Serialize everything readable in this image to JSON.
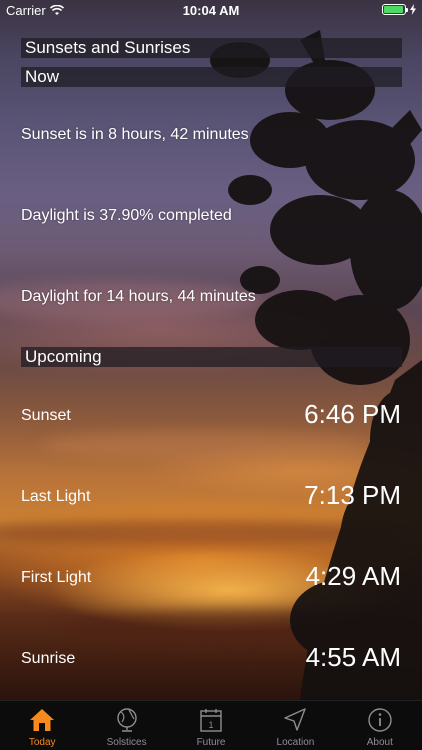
{
  "status_bar": {
    "carrier": "Carrier",
    "time": "10:04 AM",
    "battery_level": 0.95
  },
  "app_title": "Sunsets and Sunrises",
  "now_section": {
    "header": "Now",
    "sunset_countdown": "Sunset is in 8 hours, 42 minutes",
    "daylight_completed": "Daylight is 37.90% completed",
    "daylight_duration": "Daylight for 14 hours, 44 minutes"
  },
  "upcoming_section": {
    "header": "Upcoming",
    "events": [
      {
        "label": "Sunset",
        "time": "6:46 PM"
      },
      {
        "label": "Last Light",
        "time": "7:13 PM"
      },
      {
        "label": "First Light",
        "time": "4:29 AM"
      },
      {
        "label": "Sunrise",
        "time": "4:55 AM"
      }
    ]
  },
  "tab_bar": {
    "tabs": [
      {
        "label": "Today",
        "icon": "home-icon",
        "active": true
      },
      {
        "label": "Solstices",
        "icon": "globe-icon",
        "active": false
      },
      {
        "label": "Future",
        "icon": "calendar-icon",
        "active": false
      },
      {
        "label": "Location",
        "icon": "location-arrow-icon",
        "active": false
      },
      {
        "label": "About",
        "icon": "info-icon",
        "active": false
      }
    ]
  },
  "colors": {
    "accent": "#f78a1e",
    "inactive_tab": "#8e8e93",
    "battery": "#4cd964"
  }
}
